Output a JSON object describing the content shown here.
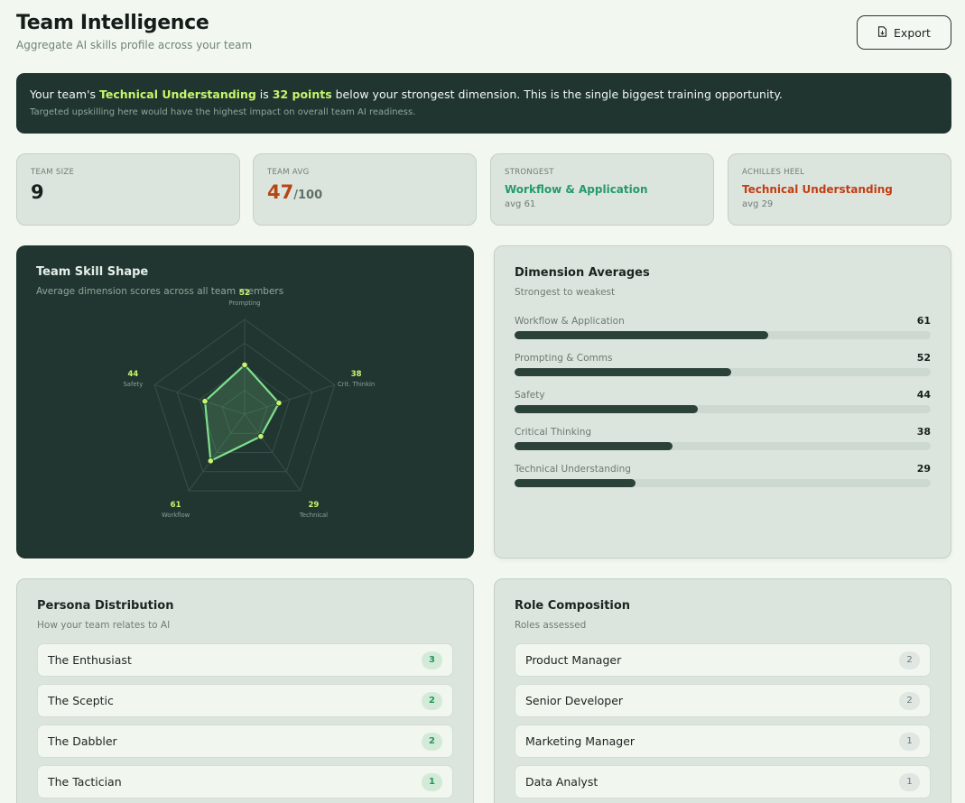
{
  "header": {
    "title": "Team Intelligence",
    "subtitle": "Aggregate AI skills profile across your team",
    "export_label": "Export"
  },
  "banner": {
    "prefix": "Your team's ",
    "dimension": "Technical Understanding",
    "middle": " is ",
    "points": "32 points",
    "suffix": " below your strongest dimension. This is the single biggest training opportunity.",
    "note": "Targeted upskilling here would have the highest impact on overall team AI readiness."
  },
  "stats": {
    "team_size": {
      "label": "TEAM SIZE",
      "value": "9"
    },
    "team_avg": {
      "label": "TEAM AVG",
      "value": "47",
      "suffix": "/100"
    },
    "strongest": {
      "label": "STRONGEST",
      "name": "Workflow & Application",
      "sub": "avg 61"
    },
    "achilles": {
      "label": "ACHILLES HEEL",
      "name": "Technical Understanding",
      "sub": "avg 29"
    }
  },
  "skill_shape": {
    "title": "Team Skill Shape",
    "subtitle": "Average dimension scores across all team members",
    "axes": [
      {
        "label": "Prompting",
        "value": 52
      },
      {
        "label": "Crit. Thinkin",
        "value": 38
      },
      {
        "label": "Technical",
        "value": 29
      },
      {
        "label": "Workflow",
        "value": 61
      },
      {
        "label": "Safety",
        "value": 44
      }
    ],
    "max": 100,
    "colors": {
      "line": "#7fe08e",
      "point": "#c8f56e",
      "value_text": "#c8f56e",
      "grid": "#35504a"
    }
  },
  "dimensions": {
    "title": "Dimension Averages",
    "subtitle": "Strongest to weakest",
    "items": [
      {
        "label": "Workflow & Application",
        "value": 61
      },
      {
        "label": "Prompting & Comms",
        "value": 52
      },
      {
        "label": "Safety",
        "value": 44
      },
      {
        "label": "Critical Thinking",
        "value": 38
      },
      {
        "label": "Technical Understanding",
        "value": 29
      }
    ]
  },
  "personas": {
    "title": "Persona Distribution",
    "subtitle": "How your team relates to AI",
    "items": [
      {
        "name": "The Enthusiast",
        "count": "3"
      },
      {
        "name": "The Sceptic",
        "count": "2"
      },
      {
        "name": "The Dabbler",
        "count": "2"
      },
      {
        "name": "The Tactician",
        "count": "1"
      }
    ]
  },
  "roles": {
    "title": "Role Composition",
    "subtitle": "Roles assessed",
    "items": [
      {
        "name": "Product Manager",
        "count": "2"
      },
      {
        "name": "Senior Developer",
        "count": "2"
      },
      {
        "name": "Marketing Manager",
        "count": "1"
      },
      {
        "name": "Data Analyst",
        "count": "1"
      }
    ]
  }
}
